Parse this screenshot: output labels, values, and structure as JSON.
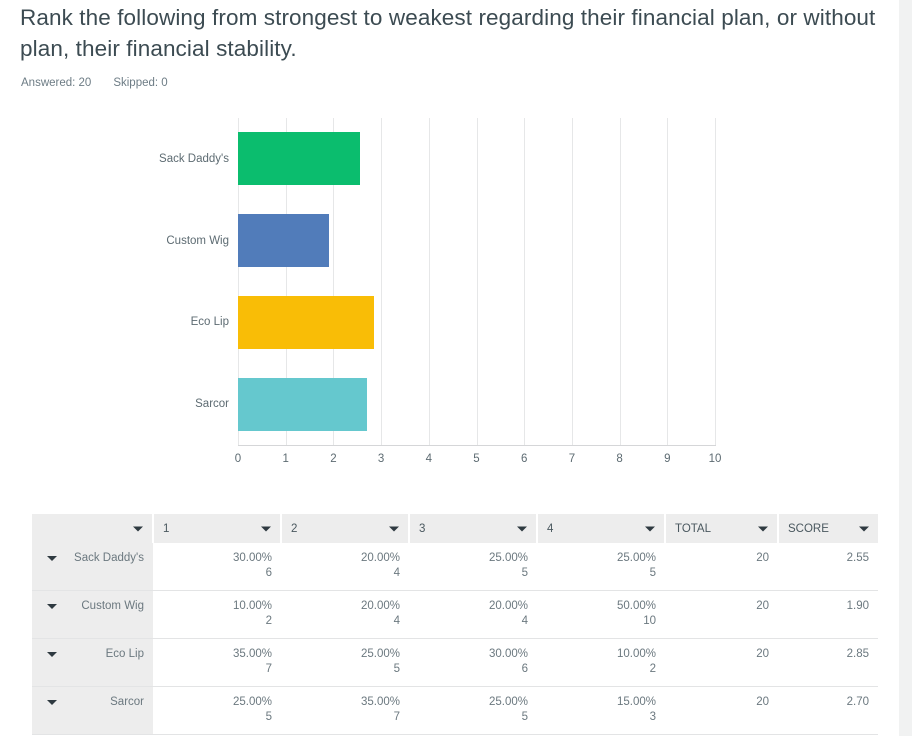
{
  "question": {
    "title": "Rank the following from strongest to weakest regarding their financial plan, or without plan, their financial stability.",
    "answered_label": "Answered: 20",
    "skipped_label": "Skipped: 0"
  },
  "chart_data": {
    "type": "bar",
    "orientation": "horizontal",
    "title": "",
    "xlabel": "",
    "ylabel": "",
    "xlim": [
      0,
      10
    ],
    "grid": true,
    "legend": "none",
    "categories": [
      "Sack Daddy's",
      "Custom Wig",
      "Eco Lip",
      "Sarcor"
    ],
    "values": [
      2.55,
      1.9,
      2.85,
      2.7
    ],
    "colors": [
      "#0bbd6e",
      "#517cba",
      "#f9bd06",
      "#65c8ce"
    ],
    "xticks": [
      "0",
      "1",
      "2",
      "3",
      "4",
      "5",
      "6",
      "7",
      "8",
      "9",
      "10"
    ]
  },
  "table": {
    "headers": [
      "",
      "1",
      "2",
      "3",
      "4",
      "TOTAL",
      "SCORE"
    ],
    "rows": [
      {
        "label": "Sack Daddy's",
        "cells": [
          {
            "pct": "30.00%",
            "count": "6"
          },
          {
            "pct": "20.00%",
            "count": "4"
          },
          {
            "pct": "25.00%",
            "count": "5"
          },
          {
            "pct": "25.00%",
            "count": "5"
          }
        ],
        "total": "20",
        "score": "2.55"
      },
      {
        "label": "Custom Wig",
        "cells": [
          {
            "pct": "10.00%",
            "count": "2"
          },
          {
            "pct": "20.00%",
            "count": "4"
          },
          {
            "pct": "20.00%",
            "count": "4"
          },
          {
            "pct": "50.00%",
            "count": "10"
          }
        ],
        "total": "20",
        "score": "1.90"
      },
      {
        "label": "Eco Lip",
        "cells": [
          {
            "pct": "35.00%",
            "count": "7"
          },
          {
            "pct": "25.00%",
            "count": "5"
          },
          {
            "pct": "30.00%",
            "count": "6"
          },
          {
            "pct": "10.00%",
            "count": "2"
          }
        ],
        "total": "20",
        "score": "2.85"
      },
      {
        "label": "Sarcor",
        "cells": [
          {
            "pct": "25.00%",
            "count": "5"
          },
          {
            "pct": "35.00%",
            "count": "7"
          },
          {
            "pct": "25.00%",
            "count": "5"
          },
          {
            "pct": "15.00%",
            "count": "3"
          }
        ],
        "total": "20",
        "score": "2.70"
      }
    ]
  }
}
